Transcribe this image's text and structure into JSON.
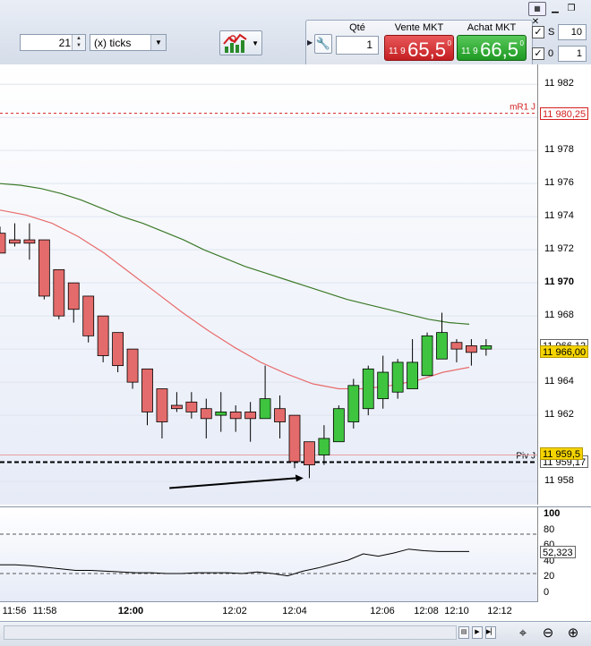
{
  "toolbar": {
    "period_value": "21",
    "period_unit": "(x) ticks"
  },
  "order_panel": {
    "qty_label": "Qté",
    "qty_value": "1",
    "sell_label": "Vente MKT",
    "sell_prefix": "11 9",
    "sell_price": "65,5",
    "sell_sup": "0",
    "buy_label": "Achat MKT",
    "buy_prefix": "11 9",
    "buy_price": "66,5",
    "buy_sup": "0"
  },
  "side_options": {
    "s_label": "S",
    "s_value": "10",
    "zero_label": "0",
    "zero_value": "1"
  },
  "colors": {
    "up": "#3fc43f",
    "down": "#e46b6b",
    "ma_long": "#3d7a2a",
    "ma_short": "#e86b6b",
    "pivot_line": "#000000",
    "mr1_line": "#d42020",
    "accent_price": "#f5d400"
  },
  "chart_data": {
    "type": "candlestick",
    "y_range": [
      11956.6,
      11983.2
    ],
    "y_ticks": [
      "11 982",
      "11 980",
      "11 978",
      "11 976",
      "11 974",
      "11 972",
      "11 970",
      "11 968",
      "11 966",
      "11 964",
      "11 962",
      "11 958"
    ],
    "y_ticks_values": [
      11982,
      11980,
      11978,
      11976,
      11974,
      11972,
      11970,
      11968,
      11966,
      11964,
      11962,
      11958
    ],
    "bold_tick": "11 970",
    "x_ticks": [
      "11:56",
      "11:58",
      "12:00",
      "12:02",
      "12:04",
      "12:06",
      "12:08",
      "12:10",
      "12:12"
    ],
    "bold_x_tick": "12:00",
    "candles": [
      {
        "o": 11973.0,
        "h": 11973.4,
        "l": 11971.8,
        "c": 11971.8
      },
      {
        "o": 11972.6,
        "h": 11973.6,
        "l": 11972.2,
        "c": 11972.4
      },
      {
        "o": 11972.6,
        "h": 11973.6,
        "l": 11971.4,
        "c": 11972.4
      },
      {
        "o": 11972.6,
        "h": 11972.6,
        "l": 11969.0,
        "c": 11969.2
      },
      {
        "o": 11970.8,
        "h": 11970.8,
        "l": 11967.8,
        "c": 11968.0
      },
      {
        "o": 11970.0,
        "h": 11970.0,
        "l": 11967.6,
        "c": 11968.4
      },
      {
        "o": 11969.2,
        "h": 11969.2,
        "l": 11966.4,
        "c": 11966.8
      },
      {
        "o": 11968.0,
        "h": 11968.0,
        "l": 11965.2,
        "c": 11965.6
      },
      {
        "o": 11967.0,
        "h": 11967.0,
        "l": 11964.6,
        "c": 11965.0
      },
      {
        "o": 11966.0,
        "h": 11966.0,
        "l": 11963.6,
        "c": 11964.0
      },
      {
        "o": 11964.8,
        "h": 11964.8,
        "l": 11961.4,
        "c": 11962.2
      },
      {
        "o": 11963.6,
        "h": 11963.6,
        "l": 11960.6,
        "c": 11961.6
      },
      {
        "o": 11962.6,
        "h": 11963.4,
        "l": 11962.2,
        "c": 11962.4
      },
      {
        "o": 11962.8,
        "h": 11963.4,
        "l": 11961.8,
        "c": 11962.2
      },
      {
        "o": 11962.4,
        "h": 11963.0,
        "l": 11960.6,
        "c": 11961.8
      },
      {
        "o": 11962.0,
        "h": 11963.4,
        "l": 11961.0,
        "c": 11962.2
      },
      {
        "o": 11962.2,
        "h": 11962.6,
        "l": 11961.0,
        "c": 11961.8
      },
      {
        "o": 11962.2,
        "h": 11962.8,
        "l": 11960.4,
        "c": 11961.8
      },
      {
        "o": 11961.8,
        "h": 11965.0,
        "l": 11961.8,
        "c": 11963.0
      },
      {
        "o": 11962.4,
        "h": 11963.2,
        "l": 11960.6,
        "c": 11961.6
      },
      {
        "o": 11962.0,
        "h": 11962.0,
        "l": 11958.8,
        "c": 11959.2
      },
      {
        "o": 11960.4,
        "h": 11960.4,
        "l": 11958.2,
        "c": 11959.0
      },
      {
        "o": 11959.6,
        "h": 11961.4,
        "l": 11959.0,
        "c": 11960.6
      },
      {
        "o": 11960.4,
        "h": 11962.6,
        "l": 11960.4,
        "c": 11962.4
      },
      {
        "o": 11961.6,
        "h": 11964.2,
        "l": 11961.2,
        "c": 11963.8
      },
      {
        "o": 11962.4,
        "h": 11965.0,
        "l": 11962.0,
        "c": 11964.8
      },
      {
        "o": 11963.0,
        "h": 11965.6,
        "l": 11962.4,
        "c": 11964.6
      },
      {
        "o": 11963.4,
        "h": 11965.4,
        "l": 11963.0,
        "c": 11965.2
      },
      {
        "o": 11963.6,
        "h": 11966.6,
        "l": 11963.6,
        "c": 11965.2
      },
      {
        "o": 11964.4,
        "h": 11967.0,
        "l": 11964.4,
        "c": 11966.8
      },
      {
        "o": 11965.4,
        "h": 11968.2,
        "l": 11965.4,
        "c": 11967.0
      },
      {
        "o": 11966.4,
        "h": 11966.6,
        "l": 11965.2,
        "c": 11966.0
      },
      {
        "o": 11966.2,
        "h": 11966.6,
        "l": 11965.0,
        "c": 11965.8
      },
      {
        "o": 11966.0,
        "h": 11966.6,
        "l": 11965.6,
        "c": 11966.2
      }
    ],
    "ma_long": [
      11976.0,
      11975.9,
      11975.7,
      11975.4,
      11975.0,
      11974.5,
      11974.0,
      11973.6,
      11973.1,
      11972.6,
      11972.0,
      11971.5,
      11971.0,
      11970.6,
      11970.2,
      11969.8,
      11969.4,
      11969.0,
      11968.7,
      11968.4,
      11968.1,
      11967.8,
      11967.6,
      11967.5
    ],
    "ma_short": [
      11974.4,
      11974.1,
      11973.6,
      11972.8,
      11971.8,
      11970.6,
      11969.4,
      11968.2,
      11967.1,
      11966.1,
      11965.2,
      11964.5,
      11963.9,
      11963.6,
      11963.6,
      11963.8,
      11964.1,
      11964.6,
      11964.9
    ],
    "ma_x_points_long": 24,
    "ma_x_points_short": 19,
    "levels": [
      {
        "name": "mR1 J",
        "value": 11980.25,
        "label": "11 980,25"
      },
      {
        "name": "Piv J",
        "value": 11959.17,
        "label": "11 959,17"
      }
    ],
    "last_price_labels": [
      "11 966,12",
      "11 966,00",
      "11 959,5"
    ],
    "arrow_from": {
      "x_index": 11.5,
      "y": 11957.6
    },
    "arrow_to": {
      "x_index": 20.6,
      "y": 11958.2
    },
    "rsi": {
      "y_range": [
        0,
        100
      ],
      "ticks": [
        "100",
        "80",
        "60",
        "40",
        "20",
        "0"
      ],
      "tick_values": [
        100,
        80,
        60,
        40,
        20,
        0
      ],
      "bold_tick": "100",
      "dashed_levels": [
        75,
        25
      ],
      "values": [
        36,
        36,
        35,
        33,
        31,
        29,
        29,
        28,
        27,
        26,
        26,
        25,
        25,
        26,
        26,
        26,
        25,
        27,
        25,
        22,
        28,
        32,
        37,
        42,
        50,
        47,
        51,
        56,
        54,
        53,
        53,
        53
      ],
      "last_label": "52,323"
    }
  }
}
